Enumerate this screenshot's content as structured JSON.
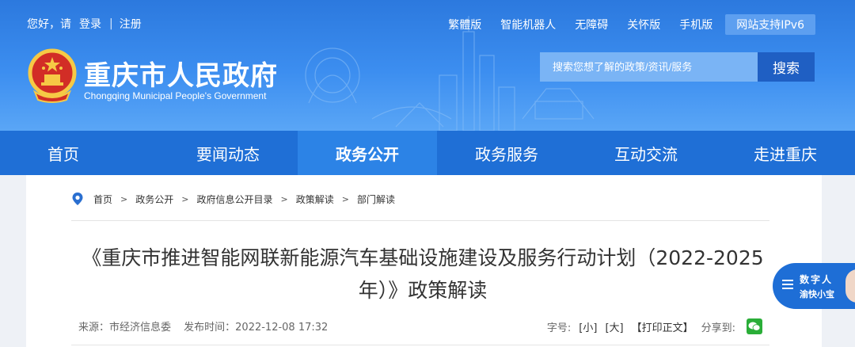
{
  "topbar": {
    "greeting": "您好，请",
    "login": "登录",
    "register": "注册",
    "links": [
      "繁體版",
      "智能机器人",
      "无障碍",
      "关怀版",
      "手机版"
    ],
    "ipv6": "网站支持IPv6"
  },
  "header": {
    "title": "重庆市人民政府",
    "subtitle": "Chongqing Municipal People's Government"
  },
  "search": {
    "placeholder": "搜索您想了解的政策/资讯/服务",
    "button": "搜索"
  },
  "nav": {
    "items": [
      {
        "label": "首页"
      },
      {
        "label": "要闻动态"
      },
      {
        "label": "政务公开"
      },
      {
        "label": "政务服务"
      },
      {
        "label": "互动交流"
      },
      {
        "label": "走进重庆"
      }
    ],
    "active_index": 2
  },
  "breadcrumb": [
    "首页",
    "政务公开",
    "政府信息公开目录",
    "政策解读",
    "部门解读"
  ],
  "article": {
    "title": "《重庆市推进智能网联新能源汽车基础设施建设及服务行动计划（2022-2025年）》政策解读",
    "source": "来源：市经济信息委",
    "publish_time": "发布时间：2022-12-08 17:32"
  },
  "tools": {
    "font_size_label": "字号:",
    "small": "[小]",
    "large": "[大]",
    "print": "【打印正文】",
    "share": "分享到:"
  },
  "widget": {
    "line1": "数字人",
    "line2": "渝快小宝"
  },
  "colors": {
    "header_blue": "#3c8ef0",
    "nav_blue": "#1f6fd6",
    "nav_active": "#2c83e6",
    "search_button": "#1f5fc3",
    "wechat_green": "#2aae38"
  }
}
